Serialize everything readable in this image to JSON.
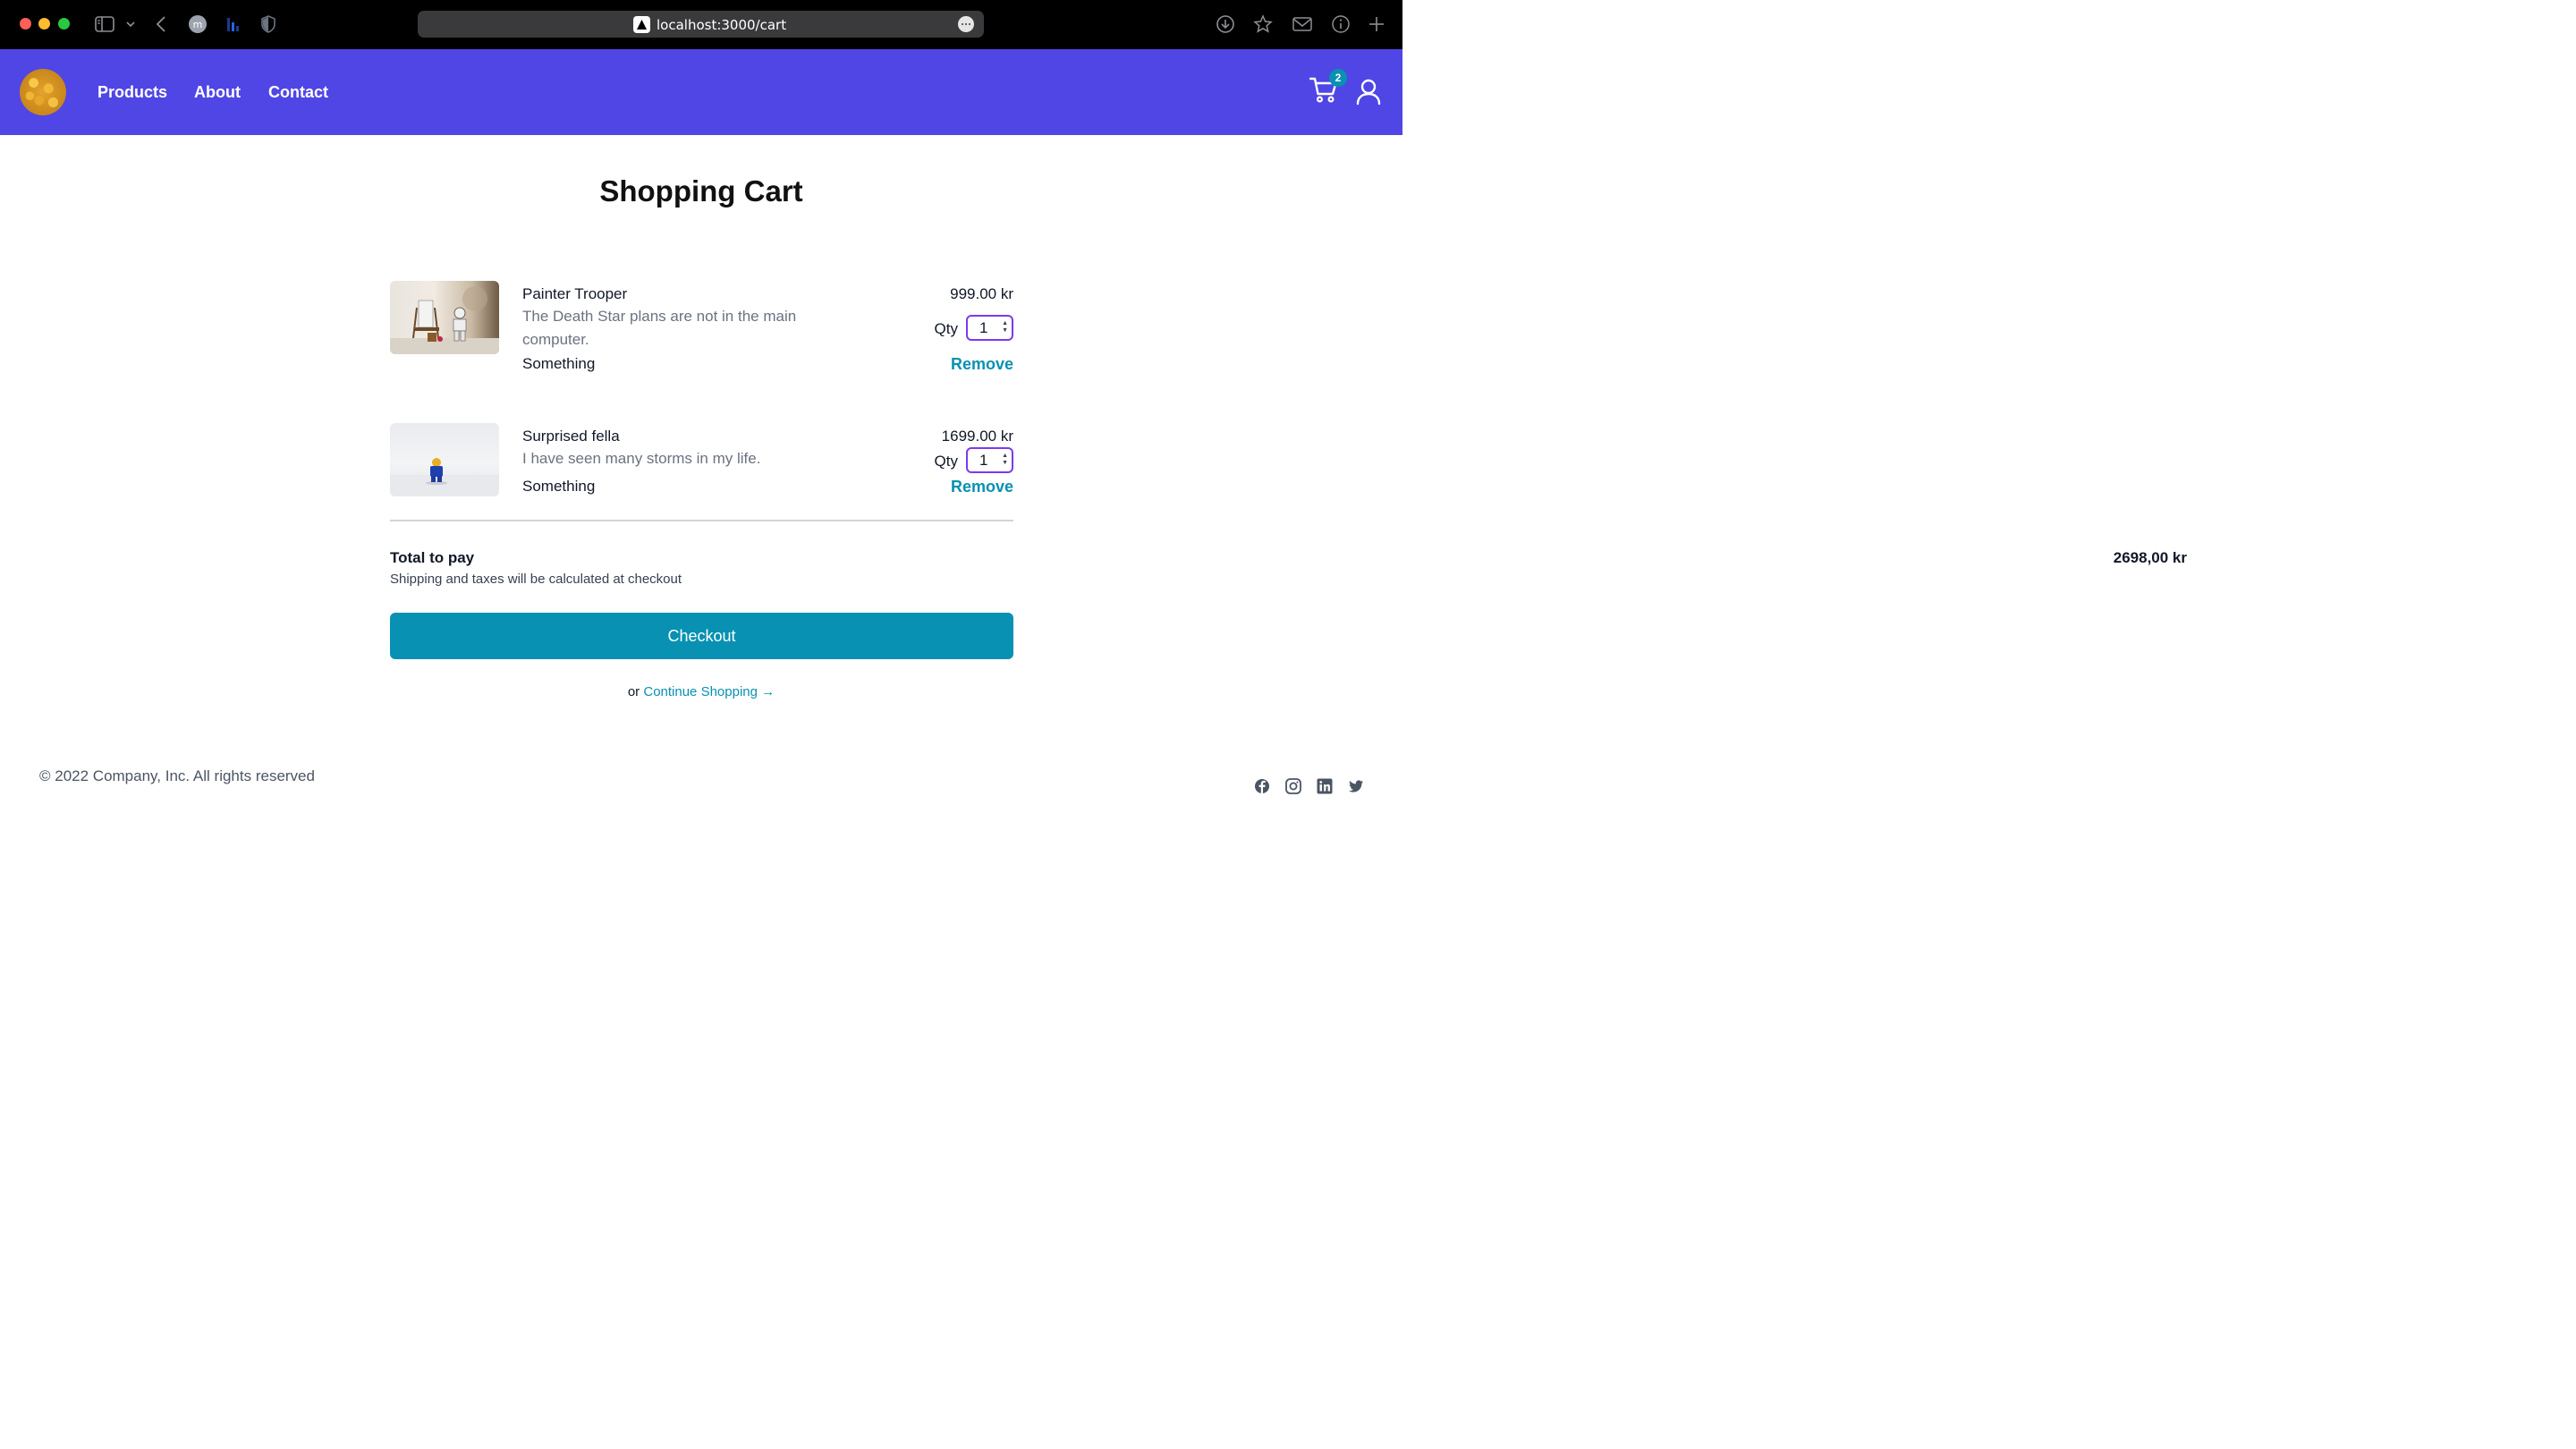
{
  "browser": {
    "url": "localhost:3000/cart"
  },
  "navbar": {
    "links": [
      {
        "label": "Products"
      },
      {
        "label": "About"
      },
      {
        "label": "Contact"
      }
    ],
    "cart_count": "2"
  },
  "cart": {
    "title": "Shopping Cart",
    "items": [
      {
        "name": "Painter Trooper",
        "description": "The Death Star plans are not in the main computer.",
        "variant": "Something",
        "price": "999.00 kr",
        "qty_label": "Qty",
        "qty": "1",
        "remove_label": "Remove"
      },
      {
        "name": "Surprised fella",
        "description": "I have seen many storms in my life.",
        "variant": "Something",
        "price": "1699.00 kr",
        "qty_label": "Qty",
        "qty": "1",
        "remove_label": "Remove"
      }
    ],
    "total_label": "Total to pay",
    "total_note": "Shipping and taxes will be calculated at checkout",
    "total_value": "2698,00 kr",
    "checkout_label": "Checkout",
    "continue_prefix": "or",
    "continue_label": "Continue Shopping →"
  },
  "footer": {
    "copyright": "© 2022 Company, Inc. All rights reserved",
    "social_icons": [
      "facebook-icon",
      "instagram-icon",
      "linkedin-icon",
      "twitter-icon"
    ]
  },
  "colors": {
    "navbar_bg": "#4f46e5",
    "accent": "#0891b2",
    "qty_border": "#7c3aed"
  }
}
